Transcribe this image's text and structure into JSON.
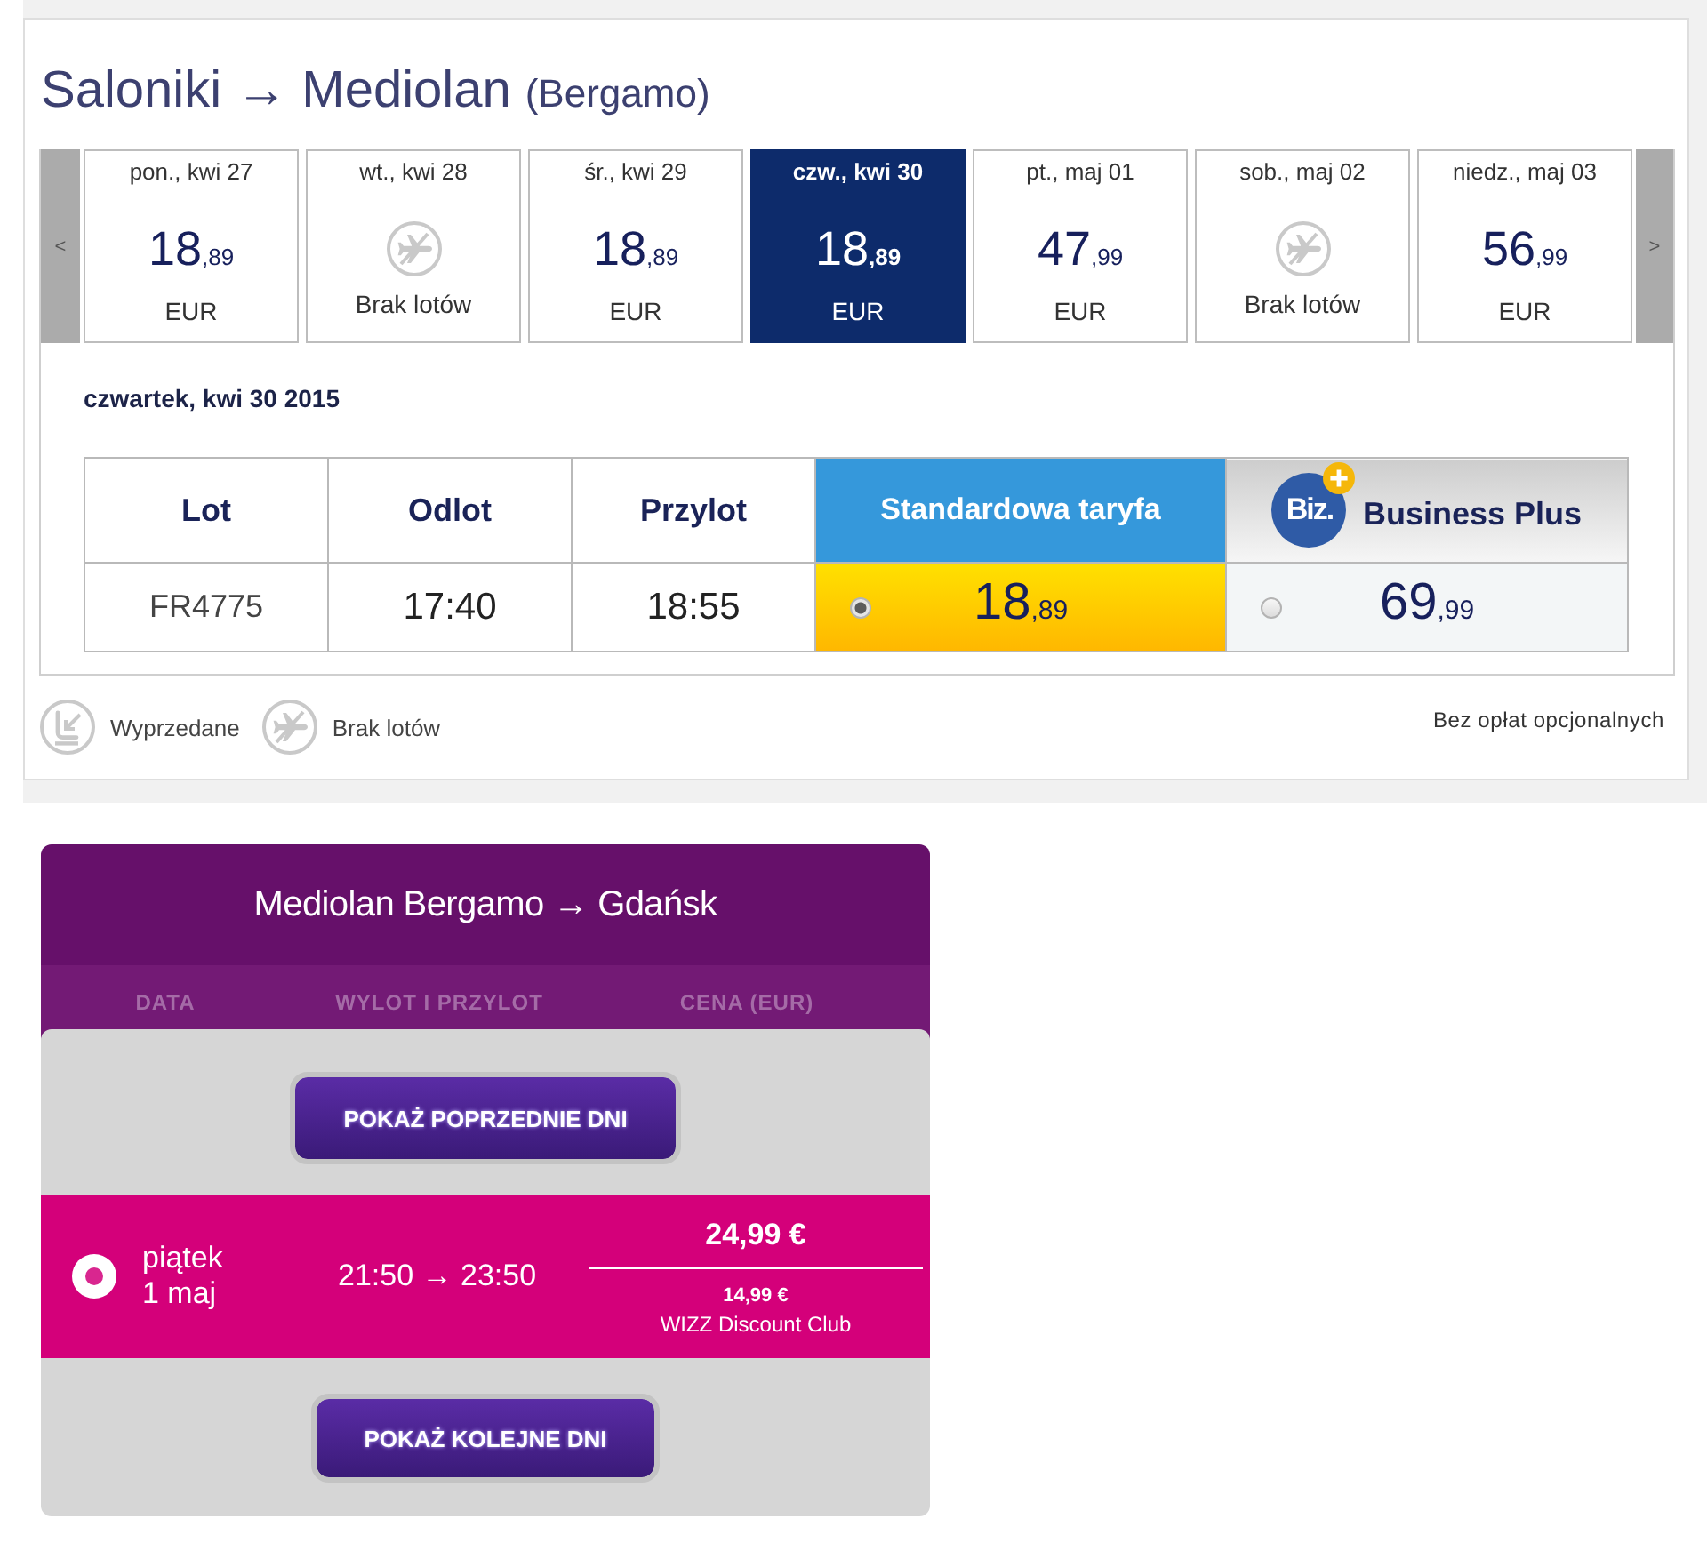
{
  "route": {
    "title": "Saloniki → Mediolan",
    "airport": "(Bergamo)"
  },
  "date_strip": {
    "prev": "<",
    "next": ">",
    "days": [
      {
        "label": "pon., kwi 27",
        "kind": "price",
        "price": "18",
        "cents": ",89",
        "currency": "EUR",
        "selected": false
      },
      {
        "label": "wt., kwi 28",
        "kind": "no_flights",
        "note": "Brak lotów",
        "selected": false
      },
      {
        "label": "śr., kwi 29",
        "kind": "price",
        "price": "18",
        "cents": ",89",
        "currency": "EUR",
        "selected": false
      },
      {
        "label": "czw., kwi 30",
        "kind": "price",
        "price": "18",
        "cents": ",89",
        "currency": "EUR",
        "selected": true
      },
      {
        "label": "pt., maj 01",
        "kind": "price",
        "price": "47",
        "cents": ",99",
        "currency": "EUR",
        "selected": false
      },
      {
        "label": "sob., maj 02",
        "kind": "no_flights",
        "note": "Brak lotów",
        "selected": false
      },
      {
        "label": "niedz., maj 03",
        "kind": "price",
        "price": "56",
        "cents": ",99",
        "currency": "EUR",
        "selected": false
      }
    ]
  },
  "selected_date": "czwartek, kwi 30 2015",
  "fare_table": {
    "columns": [
      {
        "kind": "plain",
        "label": "Lot"
      },
      {
        "kind": "plain",
        "label": "Odlot"
      },
      {
        "kind": "plain",
        "label": "Przylot"
      },
      {
        "kind": "standard",
        "label": "Standardowa taryfa"
      },
      {
        "kind": "business",
        "label": "Business Plus",
        "logo": "Biz."
      }
    ],
    "rows": [
      {
        "flight": "FR4775",
        "departure": "17:40",
        "arrival": "18:55",
        "fares": [
          {
            "price": "18",
            "cents": ",89",
            "selected": true
          },
          {
            "price": "69",
            "cents": ",99",
            "selected": false
          }
        ]
      }
    ]
  },
  "legend": [
    {
      "kind": "sold_out",
      "label": "Wyprzedane"
    },
    {
      "kind": "no_flights",
      "label": "Brak lotów"
    }
  ],
  "fee_note": "Bez opłat opcjonalnych",
  "wizz_widget": {
    "title": "Mediolan Bergamo → Gdańsk",
    "columns": [
      "DATA",
      "WYLOT I PRZYLOT",
      "CENA (EUR)"
    ],
    "prev_button": "POKAŻ POPRZEDNIE DNI",
    "flights": [
      {
        "weekday": "piątek",
        "date": "1 maj",
        "times": "21:50 → 23:50",
        "price": "24,99 €",
        "club_price": "14,99 €",
        "club_label": "WIZZ Discount Club",
        "selected": true
      }
    ],
    "next_button": "POKAŻ KOLEJNE DNI"
  }
}
